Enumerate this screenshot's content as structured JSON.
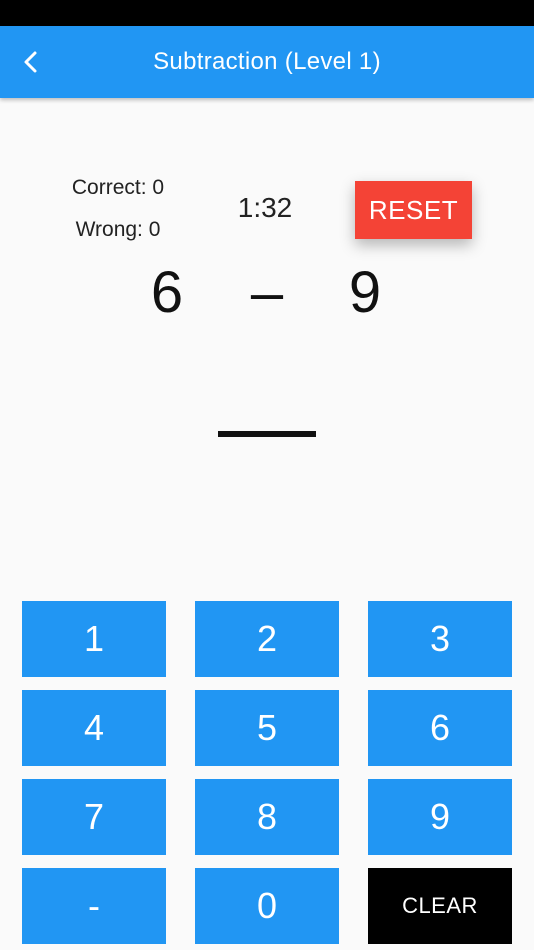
{
  "app_bar": {
    "title": "Subtraction (Level 1)",
    "background": "#2196f3"
  },
  "score": {
    "correct_label": "Correct: 0",
    "wrong_label": "Wrong: 0"
  },
  "timer": {
    "value": "1:32"
  },
  "reset": {
    "label": "RESET",
    "color": "#f44336"
  },
  "problem": {
    "left_operand": "6",
    "operator": "–",
    "right_operand": "9"
  },
  "answer": {
    "value": ""
  },
  "keypad": {
    "keys": [
      "1",
      "2",
      "3",
      "4",
      "5",
      "6",
      "7",
      "8",
      "9",
      "-",
      "0",
      "CLEAR"
    ],
    "key_color": "#2196f3",
    "clear_color": "#000000"
  },
  "icons": {
    "back": "chevron-left-icon"
  }
}
